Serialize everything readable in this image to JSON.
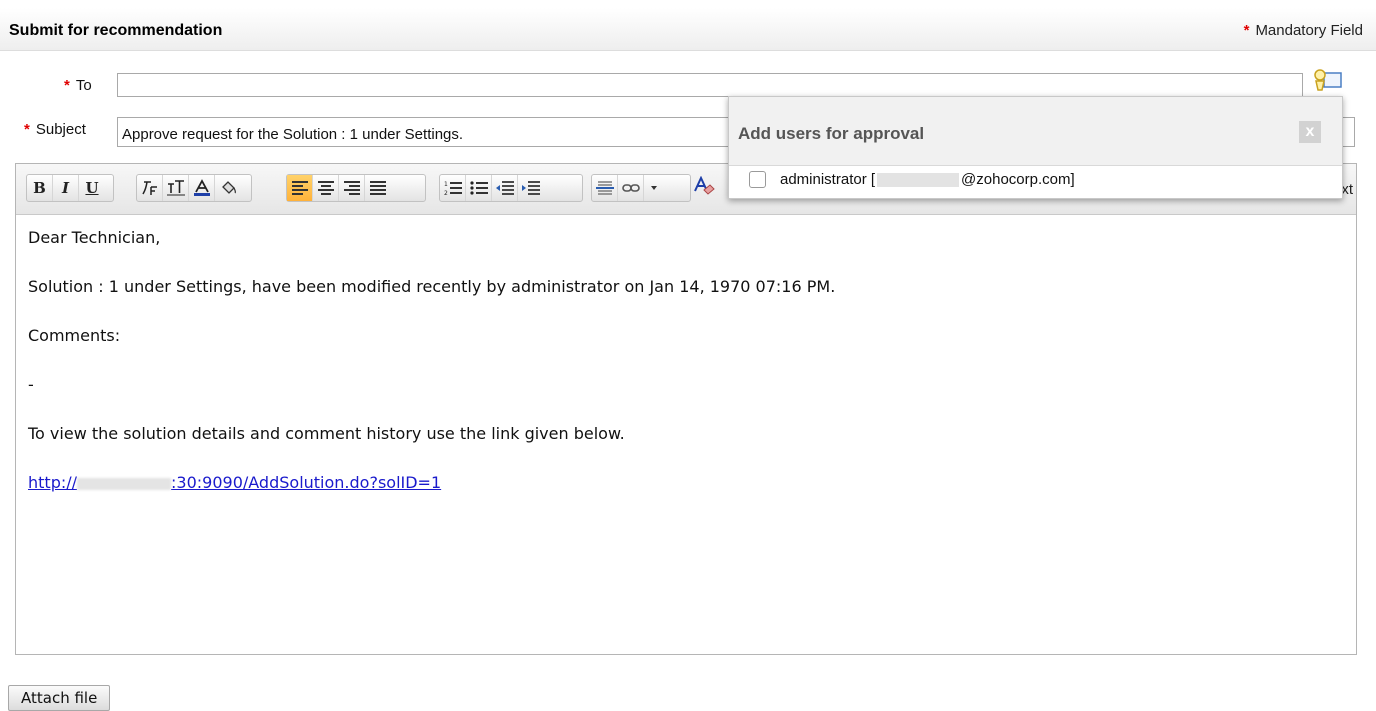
{
  "header": {
    "title": "Submit for recommendation",
    "mandatory_star": "*",
    "mandatory_label": "Mandatory Field"
  },
  "form": {
    "to_star": "*",
    "to_label": "To",
    "to_value": "",
    "subject_star": "*",
    "subject_label": "Subject",
    "subject_value": "Approve request for the Solution : 1 under Settings."
  },
  "toolbar": {
    "bold": "B",
    "italic": "I",
    "underline": "U",
    "right_text": "xt"
  },
  "body": {
    "greeting": "Dear Technician,",
    "line1": "Solution : 1 under Settings, have been modified recently by administrator on Jan 14, 1970 07:16 PM.",
    "comments_label": "Comments:",
    "comments_value": "-",
    "line2": "To view the solution details and comment history use the link given below.",
    "link_prefix": "http://",
    "link_suffix": ":30:9090/AddSolution.do?solID=1"
  },
  "attach_button": "Attach file",
  "popup": {
    "title": "Add users for approval",
    "close": "x",
    "users": [
      {
        "name_prefix": "administrator [",
        "email_suffix": "@zohocorp.com]",
        "checked": false
      }
    ]
  }
}
